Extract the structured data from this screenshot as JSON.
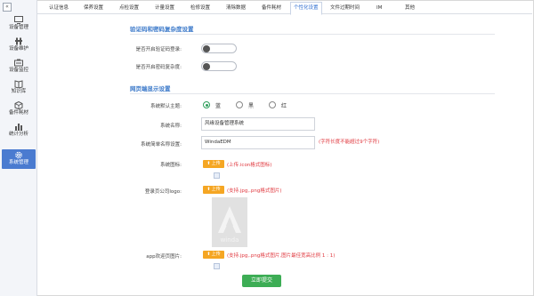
{
  "sidebar": {
    "collapse_glyph": "«",
    "items": [
      {
        "label": "设备管理",
        "icon": "monitor-icon"
      },
      {
        "label": "设备维护",
        "icon": "wrench-icon"
      },
      {
        "label": "设备监控",
        "icon": "camera-icon"
      },
      {
        "label": "知识库",
        "icon": "book-icon"
      },
      {
        "label": "备件耗材",
        "icon": "box-icon"
      },
      {
        "label": "统计分析",
        "icon": "chart-icon"
      },
      {
        "label": "系统管理",
        "icon": "gear-icon",
        "active": true
      }
    ]
  },
  "tabs": [
    {
      "label": "认证信息"
    },
    {
      "label": "保养设置"
    },
    {
      "label": "点检设置"
    },
    {
      "label": "计量设置"
    },
    {
      "label": "检修设置"
    },
    {
      "label": "清除数据"
    },
    {
      "label": "备件耗材"
    },
    {
      "label": "个性化设置",
      "active": true
    },
    {
      "label": "文件过期时间"
    },
    {
      "label": "IM"
    },
    {
      "label": "其他"
    }
  ],
  "verify_section": {
    "title": "验证码和密码复杂度设置",
    "captcha_label": "是否开启验证码登录:",
    "complexity_label": "是否开启密码复杂度:"
  },
  "display_section": {
    "title": "网页端显示设置",
    "theme_label": "系统默认主题:",
    "theme_options": [
      {
        "label": "蓝",
        "selected": true
      },
      {
        "label": "黑"
      },
      {
        "label": "红"
      }
    ],
    "system_name_label": "系统名称:",
    "system_name_value": "风缘设备管理系统",
    "short_name_label": "系统简单名称设置:",
    "short_name_value": "WindaEDM",
    "short_name_hint": "(字符长度不能超过9个字符)",
    "icon_label": "系统图标:",
    "upload_label": "上传",
    "icon_hint": "(上传.icon格式图标)",
    "login_logo_label": "登录页公司logo:",
    "login_logo_hint": "(支持.jpg,.png格式图片)",
    "login_logo_text": "winda",
    "app_splash_label": "app欢迎页图片:",
    "app_splash_hint": "(支持.jpg,.png格式图片,图片最佳宽高比例 1 : 1)",
    "submit_label": "立即提交"
  },
  "colors": {
    "accent_blue": "#4a7bd0",
    "section_blue": "#3a78c9",
    "upload_orange": "#f5a623",
    "submit_green": "#3dad55",
    "hint_red": "#e0383e",
    "radio_green": "#2e9e5b"
  }
}
